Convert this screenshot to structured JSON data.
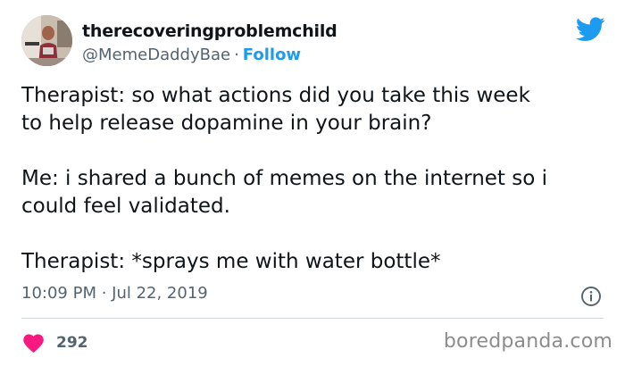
{
  "user": {
    "display_name": "therecoveringproblemchild",
    "handle": "@MemeDaddyBae",
    "separator": "·",
    "follow_label": "Follow"
  },
  "tweet": {
    "text": "Therapist: so what actions did you take this week\nto help release dopamine in your brain?\n\nMe: i shared a bunch of memes on the internet so i\ncould feel validated.\n\nTherapist: *sprays me with water bottle*",
    "timestamp": "10:09 PM · Jul 22, 2019"
  },
  "engagement": {
    "likes": "292"
  },
  "watermark": "boredpanda.com",
  "icons": {
    "logo": "twitter-bird-icon",
    "info": "info-icon",
    "like": "heart-icon"
  },
  "colors": {
    "accent": "#1d9bf0",
    "heart": "#f91880",
    "secondary_text": "#536471",
    "divider": "#cfd9de"
  }
}
